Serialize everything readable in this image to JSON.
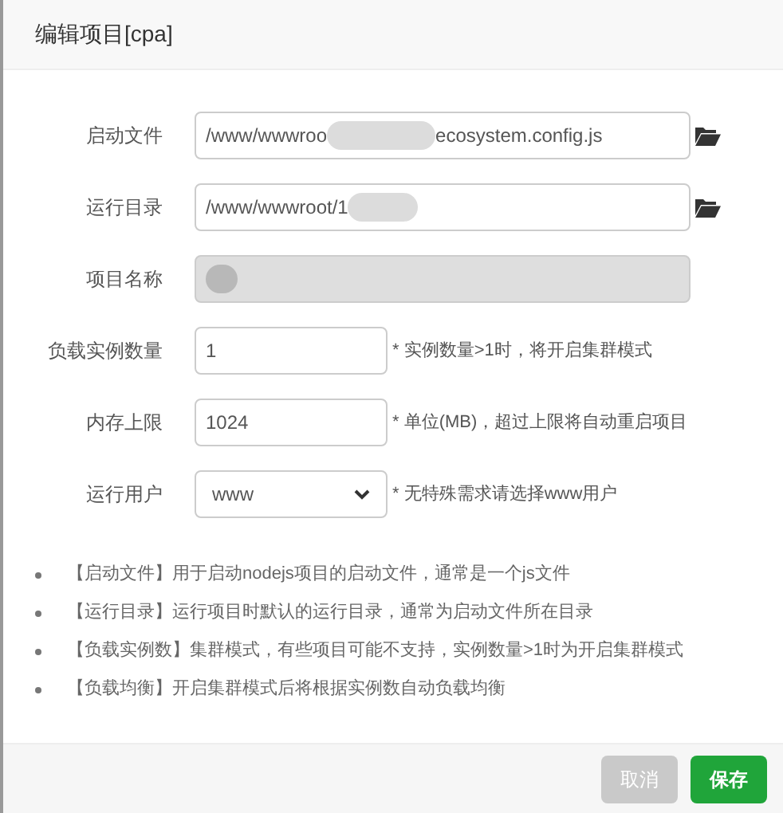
{
  "dialog": {
    "title": "编辑项目[cpa]"
  },
  "fields": [
    {
      "kind": "path",
      "label": "启动文件",
      "value_start": "/www/wwwroo",
      "redacted": true,
      "value_end": "ecosystem.config.js"
    },
    {
      "kind": "path",
      "label": "运行目录",
      "value_start": "/www/wwwroot/1",
      "redacted": true
    },
    {
      "kind": "text",
      "label": "项目名称",
      "redacted": true,
      "disabled": true
    },
    {
      "kind": "short",
      "label": "负载实例数量",
      "value_start": "1",
      "hint": "* 实例数量>1时，将开启集群模式"
    },
    {
      "kind": "short",
      "label": "内存上限",
      "value_start": "1024",
      "hint": "* 单位(MB)，超过上限将自动重启项目"
    },
    {
      "kind": "select",
      "label": "运行用户",
      "value_start": "www",
      "hint": "* 无特殊需求请选择www用户"
    }
  ],
  "notes": [
    "【启动文件】用于启动nodejs项目的启动文件，通常是一个js文件",
    "【运行目录】运行项目时默认的运行目录，通常为启动文件所在目录",
    "【负载实例数】集群模式，有些项目可能不支持，实例数量>1时为开启集群模式",
    "【负载均衡】开启集群模式后将根据实例数自动负载均衡"
  ],
  "buttons": [
    {
      "label": "取消",
      "kind": "cancel"
    },
    {
      "label": "保存",
      "kind": "primary"
    }
  ]
}
